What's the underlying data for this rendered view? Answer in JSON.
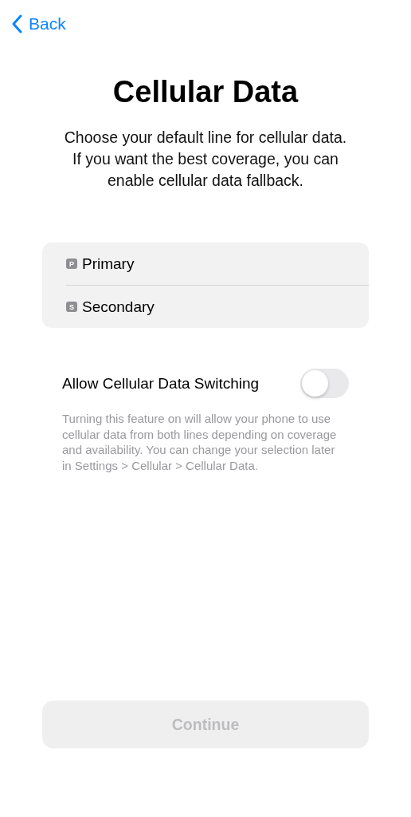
{
  "nav": {
    "back_label": "Back"
  },
  "title": "Cellular Data",
  "subtitle": "Choose your default line for cellular data. If you want the best coverage, you can enable cellular data fallback.",
  "lines": [
    {
      "badge": "P",
      "label": "Primary"
    },
    {
      "badge": "S",
      "label": "Secondary"
    }
  ],
  "switching": {
    "label": "Allow Cellular Data Switching",
    "on": false
  },
  "footnote": "Turning this feature on will allow your phone to use cellular data from both lines depending on coverage and availability. You can change your selection later in Settings > Cellular > Cellular Data.",
  "continue_button": {
    "label": "Continue",
    "disabled": true
  }
}
